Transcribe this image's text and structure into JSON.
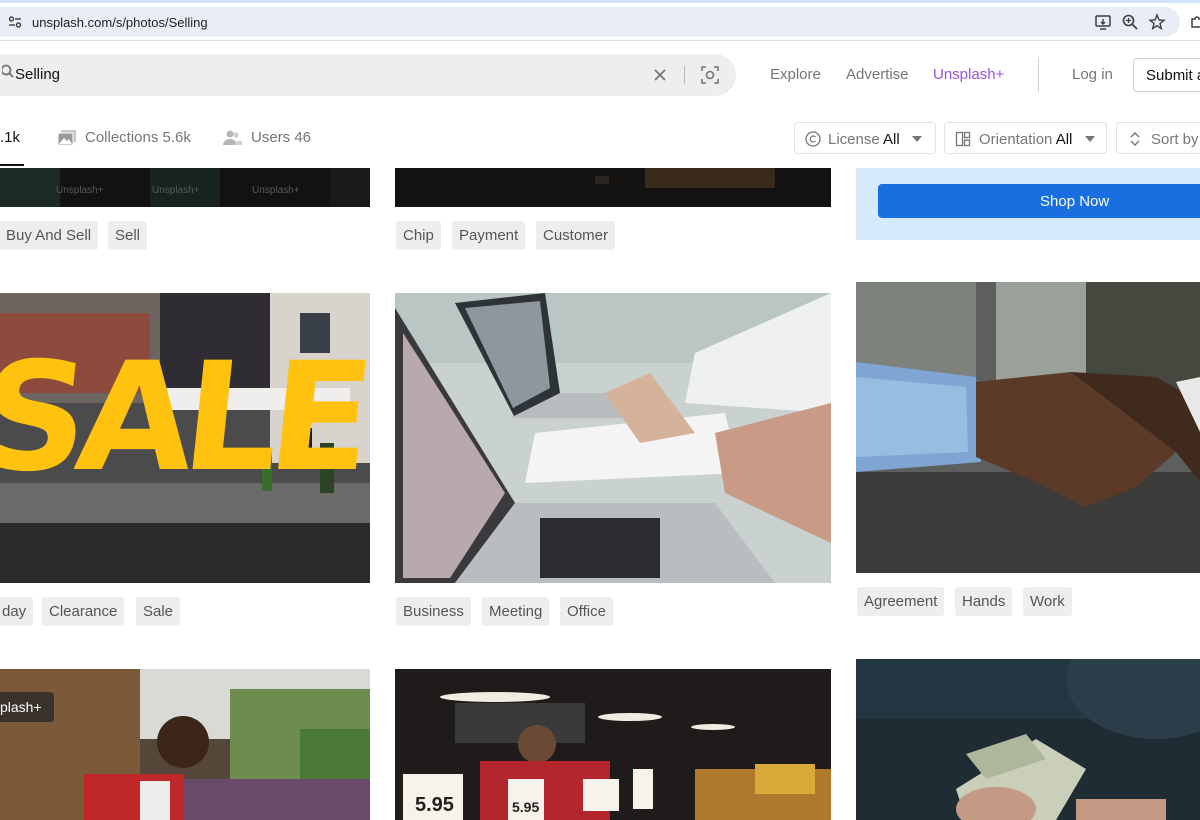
{
  "browser": {
    "url": "unsplash.com/s/photos/Selling"
  },
  "header": {
    "search_value": "Selling",
    "nav": [
      "Explore",
      "Advertise",
      "Unsplash+"
    ],
    "login": "Log in",
    "submit": "Submit a"
  },
  "tabs": {
    "photos_count": ".1k",
    "collections": "Collections 5.6k",
    "users": "Users 46"
  },
  "filters": {
    "license_label": "License",
    "license_value": "All",
    "orientation_label": "Orientation",
    "orientation_value": "All",
    "sort_label": "Sort by"
  },
  "photos": {
    "col1_top_tags": [
      "Buy And Sell",
      "Sell"
    ],
    "col1_top_watermark": "Unsplash+",
    "col2_top_tags": [
      "Chip",
      "Payment",
      "Customer"
    ],
    "col3_ad_button": "Shop Now",
    "col1_mid_tags": [
      "day",
      "Clearance",
      "Sale"
    ],
    "col1_mid_sign": "SALE",
    "col2_mid_tags": [
      "Business",
      "Meeting",
      "Office"
    ],
    "col3_mid_tags": [
      "Agreement",
      "Hands",
      "Work"
    ],
    "col1_bottom_badge": "plash+",
    "market_sign_1": "5.95",
    "market_sign_2": "5.95"
  },
  "colors": {
    "accent_plus": "#9b51e0",
    "shop_button": "#1a6fe0",
    "ad_background": "#d6ebfb"
  }
}
